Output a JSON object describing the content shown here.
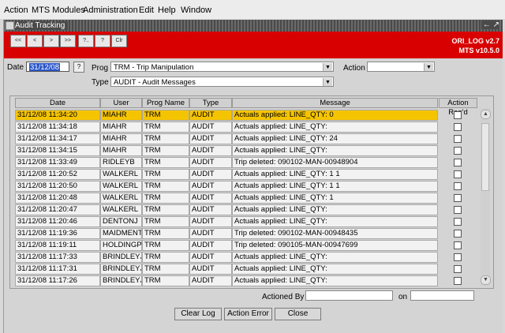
{
  "menu": [
    "Action",
    "MTS Modules",
    "Administration",
    "Edit",
    "Help",
    "Window"
  ],
  "window": {
    "title": "Audit Tracking",
    "controls": "← ↗"
  },
  "toolbar": {
    "buttons": [
      "<<",
      "<",
      ">",
      ">>",
      "?..",
      "?",
      "Clr"
    ],
    "version_line1": "ORI_LOG v2.7",
    "version_line2": "MTS v10.5.0"
  },
  "filters": {
    "date_label": "Date",
    "date_value": "31/12/08",
    "help": "?",
    "prog_label": "Prog",
    "prog_value": "TRM - Trip Manipulation",
    "action_label": "Action",
    "action_value": "",
    "type_label": "Type",
    "type_value": "AUDIT - Audit Messages"
  },
  "table": {
    "columns": [
      "Date",
      "User",
      "Prog Name",
      "Type",
      "Message",
      "Action Req'd"
    ],
    "rows": [
      [
        "31/12/08 11:34:20",
        "MIAHR",
        "TRM",
        "AUDIT",
        "Actuals applied: LINE_QTY: 0"
      ],
      [
        "31/12/08 11:34:18",
        "MIAHR",
        "TRM",
        "AUDIT",
        "Actuals applied: LINE_QTY:"
      ],
      [
        "31/12/08 11:34:17",
        "MIAHR",
        "TRM",
        "AUDIT",
        "Actuals applied: LINE_QTY: 24"
      ],
      [
        "31/12/08 11:34:15",
        "MIAHR",
        "TRM",
        "AUDIT",
        "Actuals applied: LINE_QTY:"
      ],
      [
        "31/12/08 11:33:49",
        "RIDLEYB",
        "TRM",
        "AUDIT",
        "Trip deleted: 090102-MAN-00948904"
      ],
      [
        "31/12/08 11:20:52",
        "WALKERL",
        "TRM",
        "AUDIT",
        "Actuals applied: LINE_QTY: 1 1"
      ],
      [
        "31/12/08 11:20:50",
        "WALKERL",
        "TRM",
        "AUDIT",
        "Actuals applied: LINE_QTY: 1 1"
      ],
      [
        "31/12/08 11:20:48",
        "WALKERL",
        "TRM",
        "AUDIT",
        "Actuals applied: LINE_QTY: 1"
      ],
      [
        "31/12/08 11:20:47",
        "WALKERL",
        "TRM",
        "AUDIT",
        "Actuals applied: LINE_QTY:"
      ],
      [
        "31/12/08 11:20:46",
        "DENTONJ",
        "TRM",
        "AUDIT",
        "Actuals applied: LINE_QTY:"
      ],
      [
        "31/12/08 11:19:36",
        "MAIDMENTP",
        "TRM",
        "AUDIT",
        "Trip deleted: 090102-MAN-00948435"
      ],
      [
        "31/12/08 11:19:11",
        "HOLDINGP",
        "TRM",
        "AUDIT",
        "Trip deleted: 090105-MAN-00947699"
      ],
      [
        "31/12/08 11:17:33",
        "BRINDLEYJ",
        "TRM",
        "AUDIT",
        "Actuals applied: LINE_QTY:"
      ],
      [
        "31/12/08 11:17:31",
        "BRINDLEYJ",
        "TRM",
        "AUDIT",
        "Actuals applied: LINE_QTY:"
      ],
      [
        "31/12/08 11:17:26",
        "BRINDLEYJ",
        "TRM",
        "AUDIT",
        "Actuals applied: LINE_QTY:"
      ]
    ],
    "selected_row": 0
  },
  "footer": {
    "actioned_by_label": "Actioned By",
    "actioned_by_value": "",
    "on_label": "on",
    "on_value": "",
    "buttons": [
      "Clear Log",
      "Action Error",
      "Close"
    ]
  },
  "colors": {
    "toolbar": "#d80000",
    "selection": "#f5c400"
  }
}
